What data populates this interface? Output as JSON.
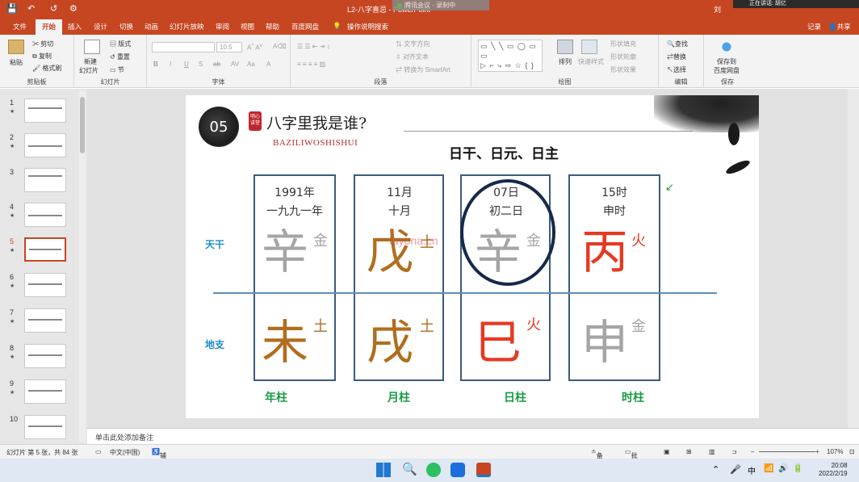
{
  "titlebar": {
    "doc_title": "L2-八字喜忌",
    "app": "PowerPoint",
    "meeting_text": "腾讯会议",
    "recording": "录制中",
    "user": "刘",
    "share_status": "正在讲话: 胡亿"
  },
  "tabs": [
    "文件",
    "开始",
    "插入",
    "设计",
    "切换",
    "动画",
    "幻灯片放映",
    "审阅",
    "视图",
    "帮助",
    "百度网盘",
    "操作说明搜索"
  ],
  "tabs_right": {
    "record": "记录",
    "share": "共享"
  },
  "ribbon": {
    "clipboard": {
      "label": "剪贴板",
      "paste": "粘贴",
      "cut": "剪切",
      "copy": "复制",
      "format_painter": "格式刷"
    },
    "slides": {
      "label": "幻灯片",
      "new_slide": "新建",
      "new_slide2": "幻灯片",
      "layout": "版式",
      "reset": "重置",
      "section": "节"
    },
    "font": {
      "label": "字体",
      "size": "10.5"
    },
    "paragraph": {
      "label": "段落",
      "text_dir": "文字方向",
      "align_text": "对齐文本",
      "smartart": "转换为 SmartArt"
    },
    "drawing": {
      "label": "绘图",
      "arrange": "排列",
      "quick_styles": "快速样式",
      "fill": "形状填充",
      "outline": "形状轮廓",
      "effects": "形状效果"
    },
    "editing": {
      "label": "编辑",
      "find": "查找",
      "replace": "替换",
      "select": "选择"
    },
    "save": {
      "label": "保存",
      "save_to": "保存到",
      "baidu": "百度网盘"
    }
  },
  "thumbnails": [
    "1",
    "2",
    "3",
    "4",
    "5",
    "6",
    "7",
    "8",
    "9",
    "10"
  ],
  "active_slide": "5",
  "slide": {
    "badge": "05",
    "seal": "明心讲堂",
    "title": "八字里我是谁?",
    "subtitle": "BAZILIWOSHISHUI",
    "heading": "日干、日元、日主",
    "row_labels": {
      "heavenly": "天干",
      "earthly": "地支"
    },
    "columns": [
      {
        "line1": "1991年",
        "line2": "一九九一年",
        "stem": "辛",
        "stem_elem": "金",
        "branch": "未",
        "branch_elem": "土",
        "name": "年柱"
      },
      {
        "line1": "11月",
        "line2": "十月",
        "stem": "戊",
        "stem_elem": "土",
        "branch": "戌",
        "branch_elem": "土",
        "name": "月柱"
      },
      {
        "line1": "07日",
        "line2": "初二日",
        "stem": "辛",
        "stem_elem": "金",
        "branch": "巳",
        "branch_elem": "火",
        "name": "日柱"
      },
      {
        "line1": "15时",
        "line2": "申时",
        "stem": "丙",
        "stem_elem": "火",
        "branch": "申",
        "branch_elem": "金",
        "name": "时柱"
      }
    ],
    "watermark": "fayona.cn"
  },
  "notes": "单击此处添加备注",
  "status": {
    "slide_info": "幻灯片 第 5 张，共 84 张",
    "lang": "中文(中国)",
    "access": "辅助功能: 调查",
    "notes_btn": "备注",
    "comments_btn": "批注",
    "zoom": "107%"
  },
  "taskbar": {
    "time": "20:08",
    "date": "2022/2/19",
    "ime": "中"
  },
  "colors": {
    "accent": "#c64621",
    "metal": "#a5a5a5",
    "earth": "#b06e1e",
    "fire": "#e53a22",
    "label_blue": "#1b8ccc",
    "pillar_green": "#1a9b45"
  }
}
